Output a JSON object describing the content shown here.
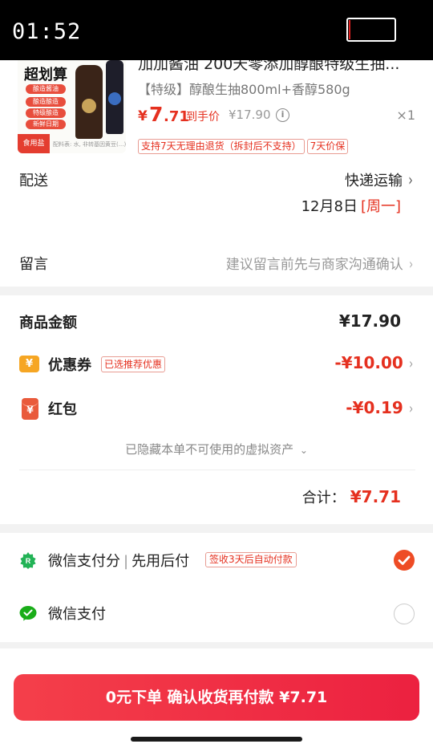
{
  "status_bar": {
    "time": "01:52"
  },
  "product": {
    "title_clipped": "加加酱油 200天零添加醇酿特级生抽...",
    "image_badge": "超划算",
    "image_chips": [
      "酿造酱油",
      "酿造酿造",
      "特级酿造",
      "新鲜日期"
    ],
    "image_salt": "食用盐",
    "image_ingredients": "配料表: 水, 非转基因黄豆(...) 食用盐",
    "spec": "【特级】醇酿生抽800ml+香醇580g",
    "price_symbol": "¥",
    "price_int": "7",
    "price_dec": ".71",
    "price_after_label": "到手价",
    "original_price": "¥17.90",
    "quantity": "×1",
    "tags": [
      "支持7天无理由退货（拆封后不支持）",
      "7天价保"
    ]
  },
  "shipping": {
    "label": "配送",
    "method": "快递运输",
    "date": "12月8日",
    "weekday": "[周一]"
  },
  "note": {
    "label": "留言",
    "placeholder": "建议留言前先与商家沟通确认"
  },
  "amounts": {
    "goods_label": "商品金额",
    "goods_value": "¥17.90",
    "coupon_label": "优惠券",
    "coupon_tag": "已选推荐优惠",
    "coupon_value": "-¥10.00",
    "redpack_label": "红包",
    "redpack_value": "-¥0.19",
    "hidden_note": "已隐藏本单不可使用的虚拟资产",
    "total_label": "合计：",
    "total_value": "¥7.71"
  },
  "payment": {
    "option1_name": "微信支付分",
    "option1_sub": "先用后付",
    "option1_tag": "签收3天后自动付款",
    "option1_selected": true,
    "option2_name": "微信支付",
    "option2_selected": false
  },
  "cta": {
    "label": "0元下单 确认收货再付款 ¥7.71"
  },
  "colors": {
    "accent": "#e5301f",
    "cta": "#f0304a",
    "wechat_green": "#1aad19"
  }
}
